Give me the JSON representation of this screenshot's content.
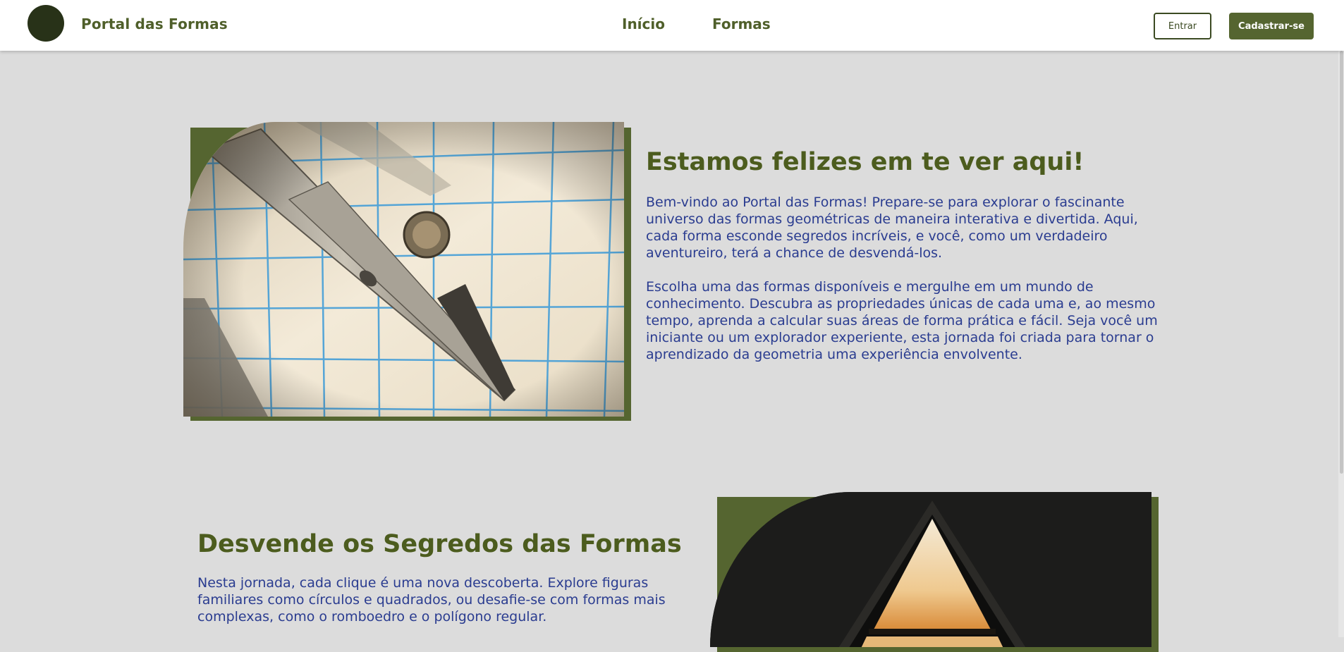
{
  "header": {
    "brand": "Portal das Formas",
    "nav": {
      "inicio": "Início",
      "formas": "Formas"
    },
    "login_label": "Entrar",
    "signup_label": "Cadastrar-se"
  },
  "welcome": {
    "title": "Estamos felizes em te ver aqui!",
    "paragraph_1": "Bem-vindo ao Portal das Formas! Prepare-se para explorar o fascinante universo das formas geométricas de maneira interativa e divertida. Aqui, cada forma esconde segredos incríveis, e você, como um verdadeiro aventureiro, terá a chance de desvendá-los.",
    "paragraph_2": "Escolha uma das formas disponíveis e mergulhe em um mundo de conhecimento. Descubra as propriedades únicas de cada uma e, ao mesmo tempo, aprenda a calcular suas áreas de forma prática e fácil. Seja você um iniciante ou um explorador experiente, esta jornada foi criada para tornar o aprendizado da geometria uma experiência envolvente."
  },
  "secrets": {
    "title": "Desvende os Segredos das Formas",
    "paragraph": "Nesta jornada, cada clique é uma nova descoberta. Explore figuras familiares como círculos e quadrados, ou desafie-se com formas mais complexas, como o romboedro e o polígono regular."
  },
  "colors": {
    "brand_green": "#4f5f2a",
    "accent_green": "#556530",
    "heading_green": "#4c5c1e",
    "body_text_blue": "#2a3c90",
    "page_background": "#dcdcdc",
    "logo_dark": "#283218"
  }
}
